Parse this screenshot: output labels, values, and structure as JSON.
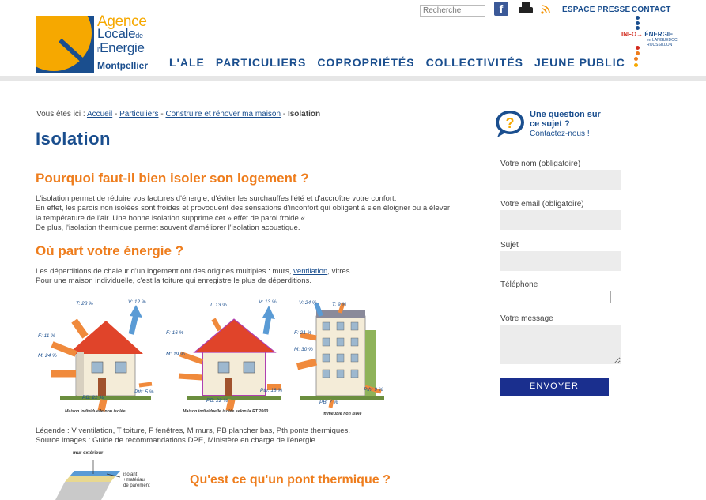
{
  "header": {
    "logo": {
      "line1": "Agence",
      "line2": "Locale",
      "line2_small": "de",
      "line3": "Energie",
      "line3_small": "l'",
      "city": "Montpellier"
    },
    "search": {
      "placeholder": "Recherche"
    },
    "top_links": {
      "presse": "ESPACE PRESSE",
      "contact": "CONTACT"
    },
    "nav": [
      "L'ALE",
      "PARTICULIERS",
      "COPROPRIÉTÉS",
      "COLLECTIVITÉS",
      "JEUNE PUBLIC"
    ],
    "partner": {
      "name1": "INFO",
      "name2": "ÉNERGIE",
      "small": "LE RÉSEAU",
      "sub": "en LANGUEDOC ROUSSILLON"
    }
  },
  "breadcrumb": {
    "prefix": "Vous êtes ici :",
    "items": [
      "Accueil",
      "Particuliers",
      "Construire et rénover ma maison"
    ],
    "current": "Isolation"
  },
  "page": {
    "title": "Isolation",
    "section1": {
      "heading": "Pourquoi faut-il bien isoler son logement ?",
      "lines": [
        "L'isolation permet de réduire vos factures d'énergie, d'éviter les surchauffes l'été et d'accroître votre confort.",
        "En effet, les parois non isolées sont froides et provoquent des sensations d'inconfort qui obligent à s'en éloigner ou à élever",
        "la température de l'air. Une bonne isolation supprime cet  » effet de paroi froide « .",
        "De plus, l'isolation thermique permet souvent d'améliorer l'isolation acoustique."
      ]
    },
    "section2": {
      "heading": "Où part votre énergie ?",
      "line1_before": "Les déperditions de chaleur d'un logement ont des origines multiples : murs,",
      "line1_link": "ventilation",
      "line1_after": ", vitres …",
      "line2": "Pour une maison individuelle, c'est la toiture qui enregistre le plus de déperditions."
    },
    "figures": [
      {
        "caption": "Maison individuelle non isolée",
        "labels": {
          "T": "T: 28 %",
          "V": "V: 12 %",
          "F": "F: 11 %",
          "M": "M: 24 %",
          "PB": "PB: 21 %",
          "Pth": "Pth: 5 %"
        }
      },
      {
        "caption": "Maison individuelle isolée selon la RT 2000",
        "labels": {
          "T": "T: 13 %",
          "V": "V: 13 %",
          "F": "F: 16 %",
          "M": "M: 19 %",
          "PB": "PB: 22 %",
          "Pth": "Pth: 18 %"
        }
      },
      {
        "caption": "Immeuble non isolé",
        "labels": {
          "V": "V: 24 %",
          "T": "T: 9 %",
          "F": "F: 21 %",
          "M": "M: 30 %",
          "PB": "PB: 7 %",
          "Pth": "Pth: 9 %"
        }
      }
    ],
    "legend_lines": [
      "Légende : V ventilation, T toiture, F fenêtres, M murs, PB plancher bas, Pth ponts thermiques.",
      "Source images : Guide de recommandations DPE, Ministère en charge de l'énergie"
    ],
    "wall_labels": {
      "wall": "mur extérieur",
      "insulant": "isolant",
      "insulant2": "+matériau",
      "insulant3": "de parement"
    },
    "section3": {
      "heading": "Qu'est ce qu'un pont thermique ?"
    }
  },
  "sidebar": {
    "question_title": "Une question sur ce sujet ?",
    "question_sub": "Contactez-nous !",
    "form": {
      "name_label": "Votre nom (obligatoire)",
      "email_label": "Votre email (obligatoire)",
      "subject_label": "Sujet",
      "phone_label": "Téléphone",
      "message_label": "Votre message",
      "submit": "ENVOYER"
    }
  },
  "colors": {
    "brand_blue": "#1a4e8e",
    "accent_orange": "#ee7d1d",
    "sun_yellow": "#f6a800",
    "button_blue": "#1a2f8e"
  }
}
